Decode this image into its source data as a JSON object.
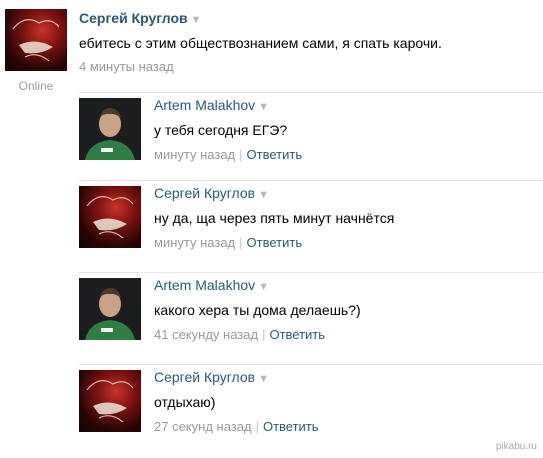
{
  "post": {
    "author": "Сергей Круглов",
    "text": "ебитесь с этим обществознанием сами, я спать карочи.",
    "time": "4 минуты назад",
    "status": "Online"
  },
  "replies": [
    {
      "author": "Artem Malakhov",
      "text": "у тебя сегодня ЕГЭ?",
      "time": "минуту назад",
      "answer": "Ответить"
    },
    {
      "author": "Сергей Круглов",
      "text": "ну да, ща через пять минут начнётся",
      "time": "минуту назад",
      "answer": "Ответить"
    },
    {
      "author": "Artem Malakhov",
      "text": "какого хера ты дома делаешь?)",
      "time": "41 секунду назад",
      "answer": "Ответить"
    },
    {
      "author": "Сергей Круглов",
      "text": "отдыхаю)",
      "time": "27 секунд назад",
      "answer": "Ответить"
    }
  ],
  "separator": "|",
  "chevron_icon": "chevron-down-icon",
  "watermark": "pikabu.ru",
  "colors": {
    "link": "#2b587a",
    "muted": "#999999",
    "divider": "#e4e6ea"
  }
}
